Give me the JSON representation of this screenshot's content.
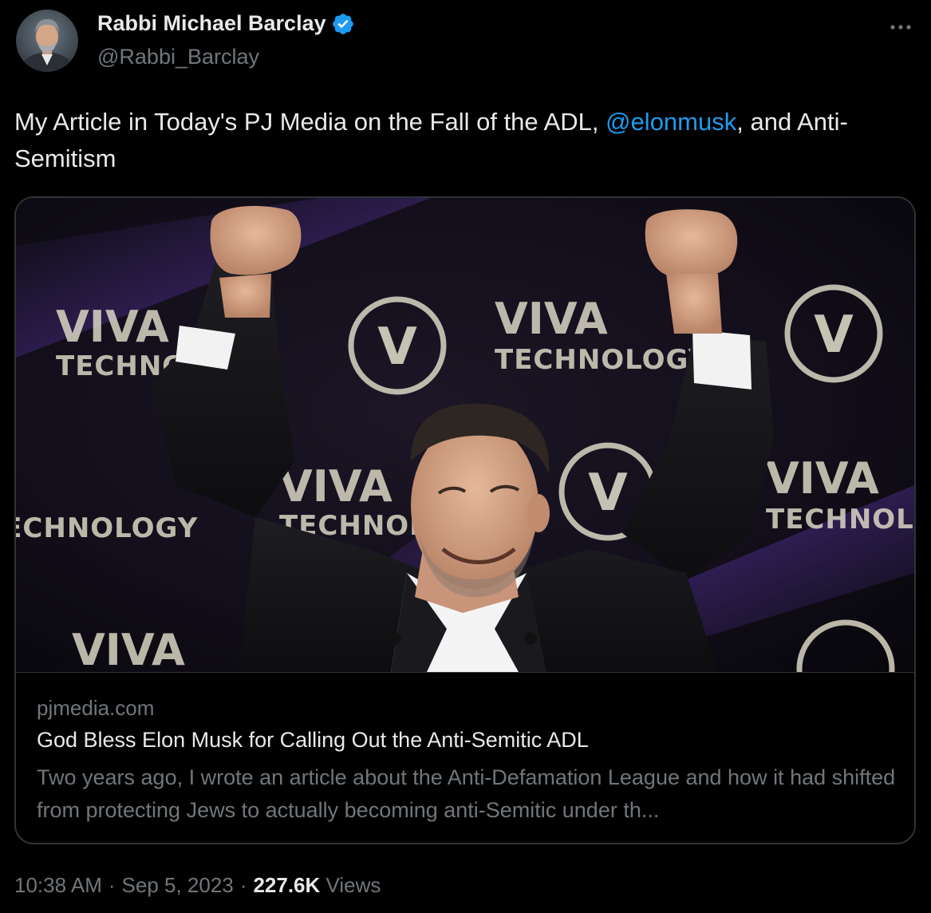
{
  "author": {
    "name": "Rabbi Michael Barclay",
    "handle": "@Rabbi_Barclay",
    "verified_color": "#1d9bf0"
  },
  "more_icon": "more-horizontal-icon",
  "tweet": {
    "text_before": "My Article in Today's PJ Media on the Fall of the ADL, ",
    "mention": "@elonmusk",
    "text_after": ", and Anti-Semitism"
  },
  "card": {
    "image_text": {
      "logo_word_1": "VIVA",
      "logo_word_2": "TECHNOLOGY",
      "logo_letter": "V"
    },
    "domain": "pjmedia.com",
    "title": "God Bless Elon Musk for Calling Out the Anti-Semitic ADL",
    "description": "Two years ago, I wrote an article about the Anti-Defamation League and how it had shifted from protecting Jews to actually becoming anti-Semitic under th..."
  },
  "meta": {
    "time": "10:38 AM",
    "separator": "·",
    "date": "Sep 5, 2023",
    "views_count": "227.6K",
    "views_label": "Views"
  },
  "colors": {
    "background": "#000000",
    "text_primary": "#e7e9ea",
    "text_secondary": "#71767b",
    "link": "#1d9bf0",
    "border": "#2f3336"
  }
}
